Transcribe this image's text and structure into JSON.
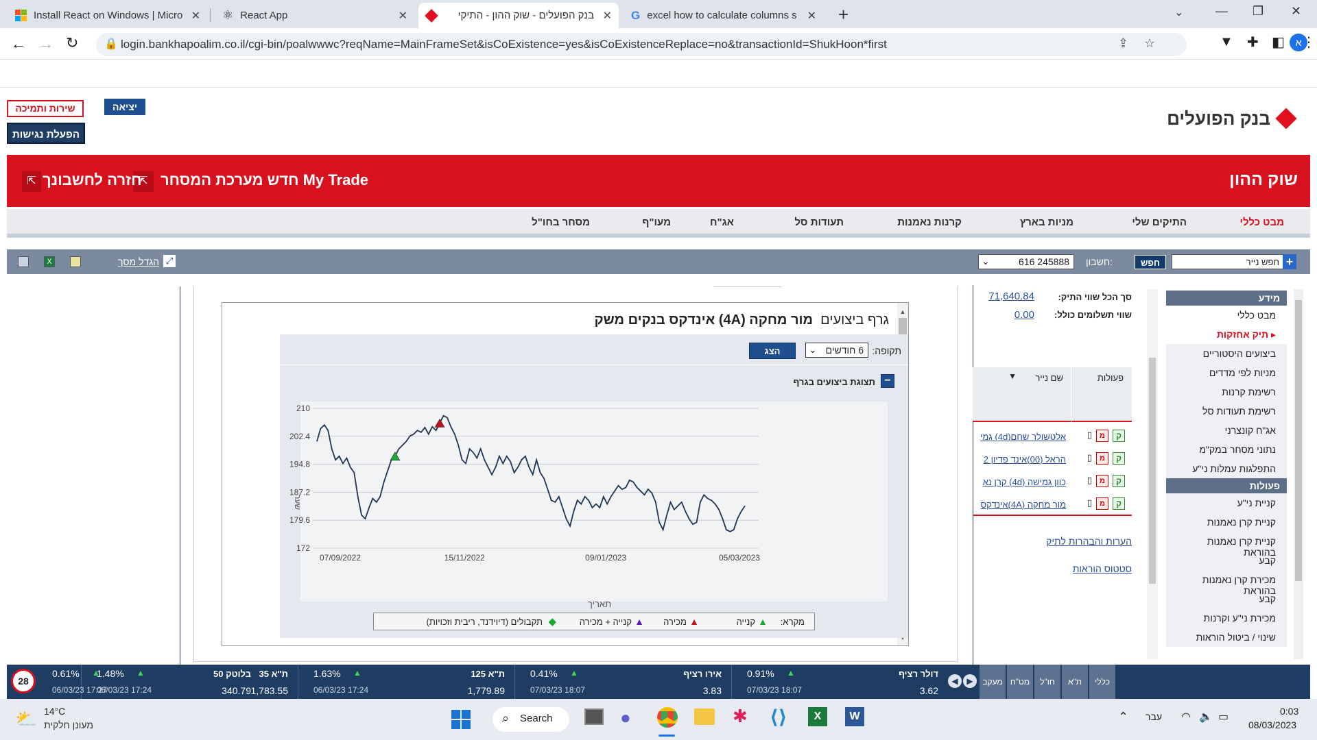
{
  "browser": {
    "tabs": [
      {
        "label": "Install React on Windows | Micro"
      },
      {
        "label": "React App"
      },
      {
        "label": "בנק הפועלים - שוק ההון - התיקי"
      },
      {
        "label": "excel how to calculate columns s"
      }
    ],
    "url": "login.bankhapoalim.co.il/cgi-bin/poalwwwc?reqName=MainFrameSet&isCoExistence=yes&isCoExistenceReplace=no&transactionId=ShukHoon*first",
    "profile_initial": "א"
  },
  "header": {
    "logo_text": "בנק הפועלים",
    "exit_label": "יציאה",
    "support_label": "שירות ותמיכה",
    "accessibility_label": "הפעלת נגישות"
  },
  "redbar": {
    "title": "שוק ההון",
    "mytrade": "חדש מערכת המסחר My Trade",
    "back": "חזרה לחשבונך"
  },
  "menu": [
    "מבט כללי",
    "התיקים שלי",
    "מניות בארץ",
    "קרנות נאמנות",
    "תעודות סל",
    "אג\"ח",
    "מעו\"ף",
    "מסחר בחו\"ל"
  ],
  "toolbar": {
    "search_placeholder": "חפש נייר",
    "search_button": "חפש",
    "account_label": "חשבון:",
    "account_value": "245888 616",
    "enlarge": "הגדל מסך"
  },
  "sidebar": {
    "section1": "מידע",
    "items1": [
      "מבט כללי",
      "תיק אחזקות",
      "ביצועים היסטוריים",
      "מניות לפי מדדים",
      "רשימת קרנות",
      "רשימת תעודות סל",
      "אג\"ח קונצרני",
      "נתוני מסחר במק\"מ",
      "התפלגות עמלות ני\"ע"
    ],
    "section2": "פעולות",
    "items2": [
      "קניית ני\"ע",
      "קניית קרן נאמנות",
      "קניית קרן נאמנות בהוראת",
      "קבע",
      "מכירת קרן נאמנות בהוראת",
      "קבע",
      "מכירת ני\"ע וקרנות",
      "שינוי / ביטול הוראות"
    ]
  },
  "portfolio": {
    "total_label": "סך הכל שווי התיק:",
    "total_value": "71,640.84",
    "pay_label": "שווי תשלומים כולל:",
    "pay_value": "0.00",
    "col_actions": "פעולות",
    "col_name": "שם נייר",
    "rows": [
      "אלטשולר שחם(4d) גמי",
      "הראל (00)אינד פדיון 2",
      "כוון גמישה (4d) קרן נא",
      "מור מחקה (4A)אינדקס"
    ],
    "btn_buy": "ק",
    "btn_sell": "מ",
    "notes_link": "הערות והבהרות לתיק",
    "status_link": "סטטוס הוראות"
  },
  "chart_panel": {
    "title_prefix": "גרף ביצועים",
    "title_name": "מור מחקה (4A) אינדקס בנקים משק",
    "period_label": "תקופה:",
    "period_value": "6 חודשים",
    "show_button": "הצג",
    "section_title": "תצוגת ביצועים בגרף",
    "legend_label": "מקרא:",
    "legend": [
      "קנייה",
      "מכירה",
      "קנייה + מכירה",
      "תקבולים (דיוידנד, ריבית וזכויות)"
    ]
  },
  "chart_data": {
    "type": "line",
    "xlabel": "תאריך",
    "ylabel": "שער",
    "ylim": [
      172,
      210
    ],
    "yticks": [
      "210",
      "202.4",
      "194.8",
      "187.2",
      "179.6",
      "172"
    ],
    "xticks": [
      "07/09/2022",
      "15/11/2022",
      "09/01/2023",
      "05/03/2023"
    ],
    "grid": true,
    "values": [
      201,
      204.5,
      205.5,
      204,
      199,
      196,
      197,
      195,
      196.5,
      194,
      192.5,
      186,
      181,
      180,
      183,
      185.5,
      184.5,
      186,
      190,
      193,
      196,
      197,
      199,
      200,
      201,
      202.5,
      203,
      204,
      203.5,
      204.8,
      203,
      205,
      204,
      206,
      208,
      207.5,
      205,
      203,
      200,
      196,
      195,
      199,
      198,
      196.5,
      199,
      196,
      194,
      192,
      194,
      197,
      195,
      197,
      195.5,
      192.5,
      194,
      196,
      197,
      194,
      192,
      196,
      192.5,
      191,
      188,
      185,
      184.5,
      186,
      183,
      180,
      178,
      182,
      185,
      184,
      186,
      185,
      183,
      184,
      183,
      186,
      184,
      186,
      187.5,
      189,
      188,
      188.5,
      190.5,
      190,
      188.5,
      187.5,
      186.5,
      188,
      187,
      184.5,
      179,
      177,
      181,
      184.5,
      182.5,
      183.5,
      184.5,
      182,
      180,
      178.5,
      179,
      184.5,
      186.5,
      185.5,
      185,
      184,
      182.5,
      180,
      177,
      176.5,
      177,
      180,
      182,
      183.5
    ],
    "markers": [
      {
        "kind": "buy",
        "index": 21,
        "color": "#1aa830"
      },
      {
        "kind": "sell",
        "index": 33,
        "color": "#c0101a"
      }
    ],
    "colors": {
      "line": "#1e3450",
      "buy": "#1aa830",
      "sell": "#c0101a",
      "both": "#5a1fb0",
      "income": "#1aa830"
    }
  },
  "ticker": [
    {
      "name": "דולר רציף",
      "change": "0.91%",
      "time": "07/03/23 18:07",
      "value": "3.62"
    },
    {
      "name": "אירו רציף",
      "change": "0.41%",
      "time": "07/03/23 18:07",
      "value": "3.83"
    },
    {
      "name": "ת\"א 125",
      "change": "1.63%",
      "time": "06/03/23 17:24",
      "value": "1,779.89"
    },
    {
      "name": "ת\"א 35",
      "change": "1.48%",
      "time": "06/03/23 17:24",
      "value": "1,783.55"
    },
    {
      "name": "בלוטק 50",
      "change": "0.61%",
      "time": "06/03/23 17:27",
      "value": "340.79"
    }
  ],
  "ticker_tabs": [
    "כללי",
    "ת\"א",
    "חו\"ל",
    "מט\"ח",
    "מעקב"
  ],
  "ticker_badge": "28",
  "taskbar": {
    "temp": "14°C",
    "weather": "מעונן חלקית",
    "search": "Search",
    "lang": "עבר",
    "time": "0:03",
    "date": "08/03/2023"
  }
}
